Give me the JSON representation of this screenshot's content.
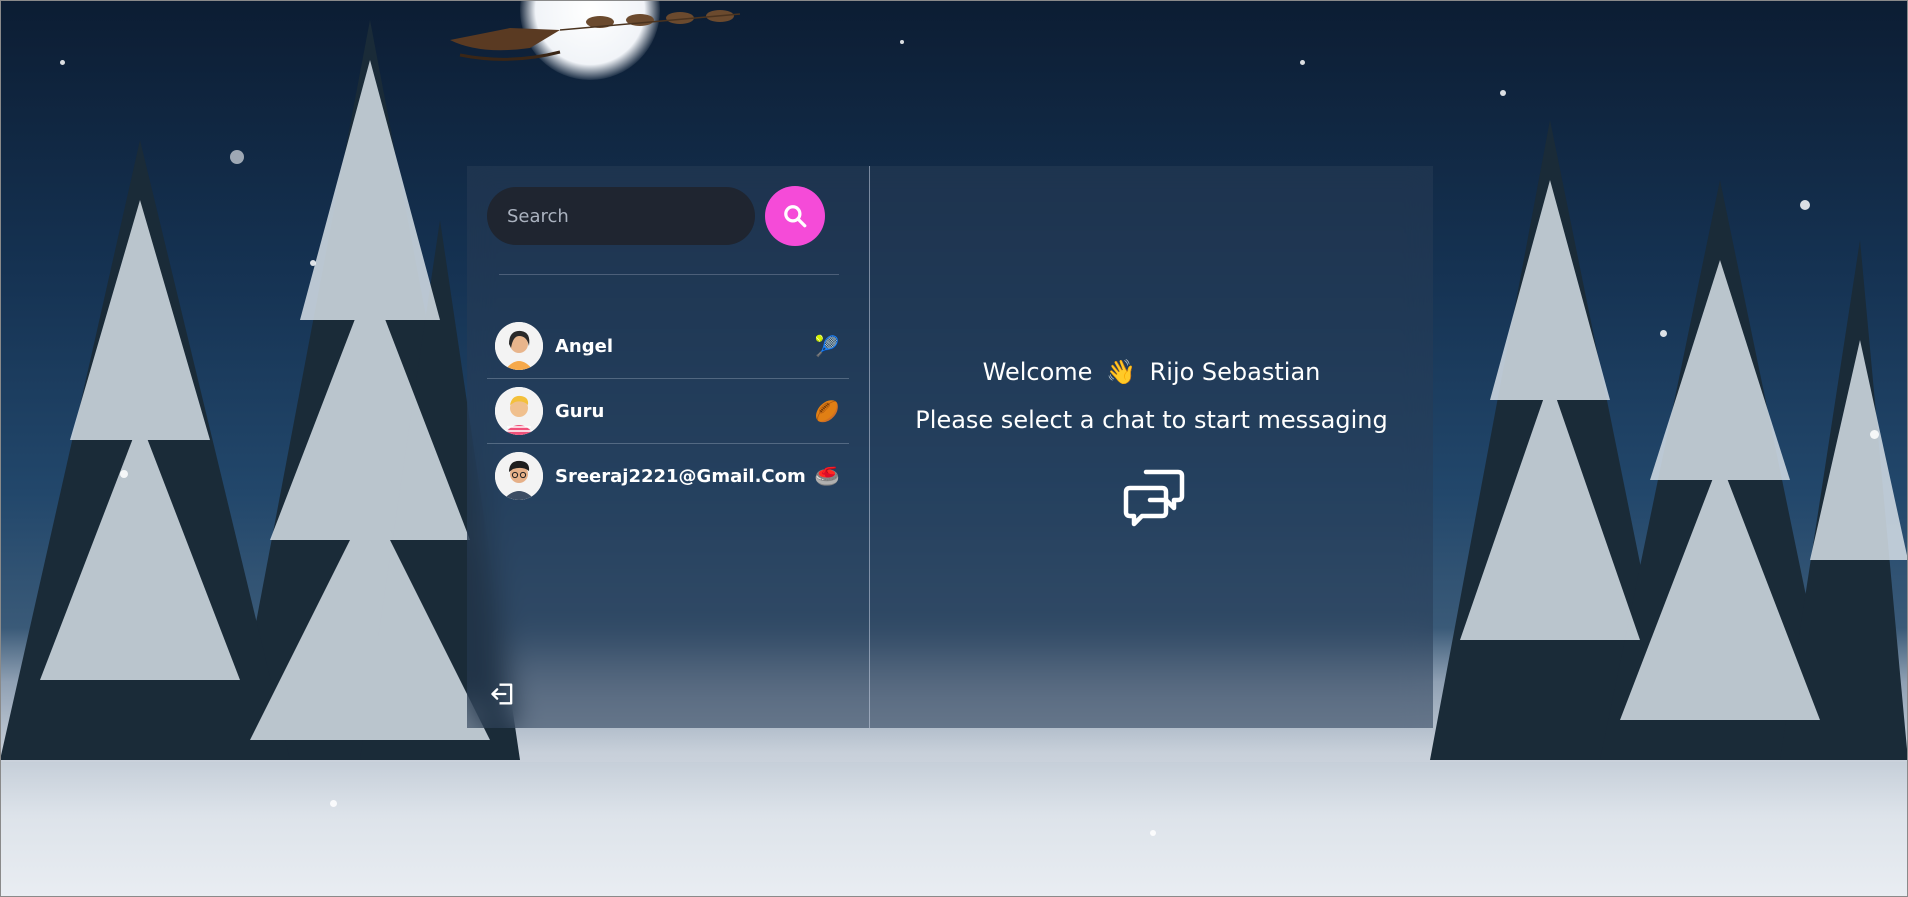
{
  "search": {
    "placeholder": "Search",
    "button_icon": "search-icon",
    "button_color": "#f54bd8"
  },
  "chats": [
    {
      "name": "Angel",
      "avatar": "avatar-woman-icon",
      "emoji": "🎾"
    },
    {
      "name": "Guru",
      "avatar": "avatar-man-pink-shirt-icon",
      "emoji": "🏉"
    },
    {
      "name": "Sreeraj2221@Gmail.Com",
      "avatar": "avatar-man-glasses-icon",
      "emoji": "🥌"
    }
  ],
  "sidebar": {
    "logout_icon": "logout-icon"
  },
  "main": {
    "welcome_prefix": "Welcome",
    "welcome_emoji": "👋",
    "user_name": "Rijo Sebastian",
    "prompt": "Please select a chat to start messaging",
    "empty_icon": "chat-bubbles-icon"
  },
  "colors": {
    "panel": "rgba(40,60,85,0.55)",
    "search_bg": "#1f2530",
    "accent": "#f54bd8"
  }
}
